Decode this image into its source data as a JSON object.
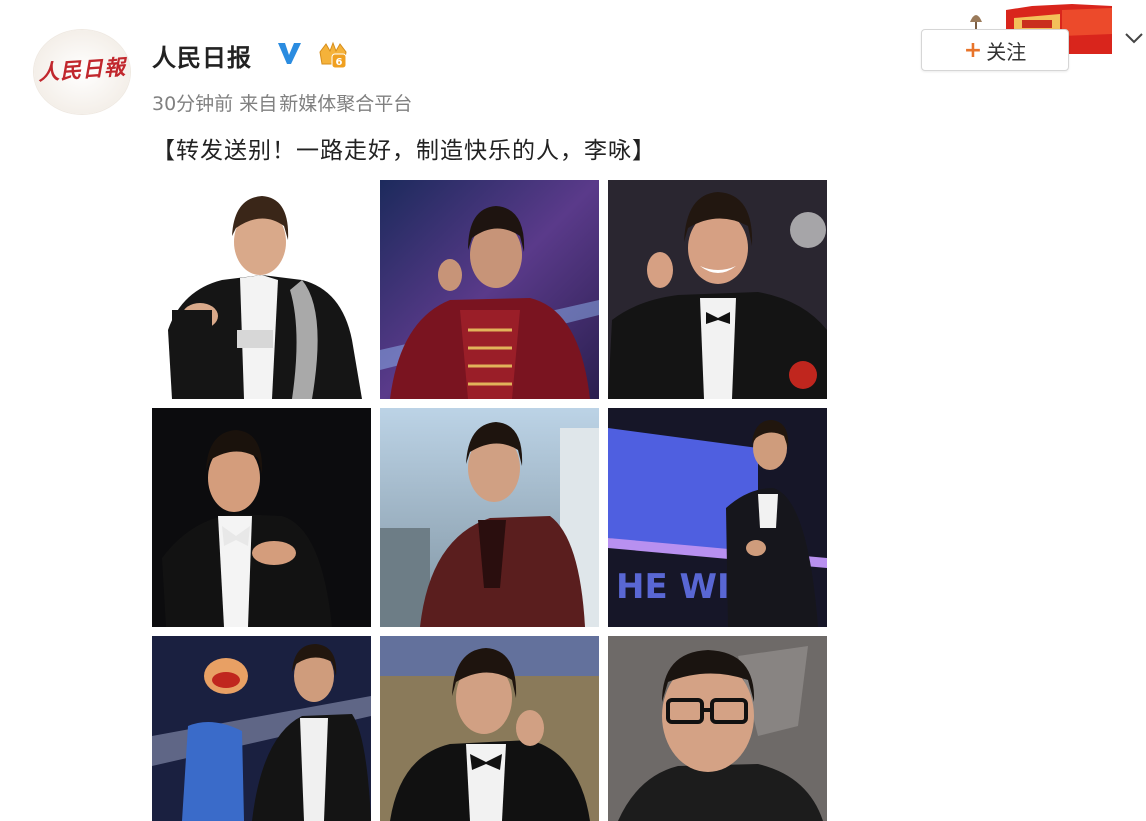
{
  "post": {
    "author": "人民日报",
    "avatar_text": "人民日報",
    "time": "30分钟前",
    "source_prefix": "来自",
    "source": "新媒体聚合平台",
    "text": "【转发送别！一路走好，制造快乐的人，李咏】"
  },
  "follow": {
    "plus": "+",
    "label": "关注"
  },
  "icons": {
    "verified": "verified-v-icon",
    "badge": "membership-badge-icon",
    "more": "chevron-down-icon"
  },
  "colors": {
    "brand_red": "#c1272d",
    "verified_blue": "#2b8ce0",
    "follow_plus": "#e8742a",
    "meta_gray": "#808080"
  },
  "grid": {
    "photos": [
      {
        "scene": "white-background",
        "outfit": "black tuxedo with sequin lapel"
      },
      {
        "scene": "blue stage",
        "outfit": "red velvet jacket"
      },
      {
        "scene": "stage",
        "outfit": "tuxedo with bow tie"
      },
      {
        "scene": "black background",
        "outfit": "tuxedo"
      },
      {
        "scene": "city skyline",
        "outfit": "dark red suit"
      },
      {
        "scene": "stage screen",
        "outfit": "suit with microphone"
      },
      {
        "scene": "stage",
        "outfit": "tuxedo with puppet"
      },
      {
        "scene": "stage",
        "outfit": "tuxedo"
      },
      {
        "scene": "gray background",
        "outfit": "glasses"
      }
    ]
  }
}
